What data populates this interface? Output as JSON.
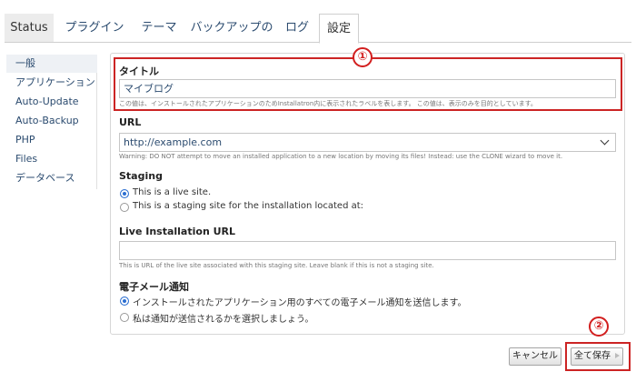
{
  "tabs": [
    {
      "label": "Status"
    },
    {
      "label": "プラグイン"
    },
    {
      "label": "テーマ"
    },
    {
      "label": "バックアップの"
    },
    {
      "label": "ログ"
    },
    {
      "label": "設定"
    }
  ],
  "sidebar": {
    "items": [
      {
        "label": "一般"
      },
      {
        "label": "アプリケーション"
      },
      {
        "label": "Auto-Update"
      },
      {
        "label": "Auto-Backup"
      },
      {
        "label": "PHP"
      },
      {
        "label": "Files"
      },
      {
        "label": "データベース"
      }
    ]
  },
  "form": {
    "title": {
      "label": "タイトル",
      "value": "マイブログ",
      "help": "この値は、インストールされたアプリケーションのためInstallatron内に表示されたラベルを表します。 この値は、表示のみを目的としています。"
    },
    "url": {
      "label": "URL",
      "value": "http://example.com",
      "help": "Warning: DO NOT attempt to move an installed application to a new location by moving its files! Instead: use the CLONE wizard to move it."
    },
    "staging": {
      "label": "Staging",
      "options": [
        "This is a live site.",
        "This is a staging site for the installation located at:"
      ]
    },
    "live_url": {
      "label": "Live Installation URL",
      "value": "",
      "help": "This is URL of the live site associated with this staging site. Leave blank if this is not a staging site."
    },
    "email": {
      "label": "電子メール通知",
      "options": [
        "インストールされたアプリケーション用のすべての電子メール通知を送信します。",
        "私は通知が送信されるかを選択しましょう。"
      ]
    }
  },
  "buttons": {
    "cancel": "キャンセル",
    "save_all": "全て保存"
  },
  "annotations": {
    "one": "①",
    "two": "②"
  },
  "colors": {
    "annotation_red": "#cc2424",
    "link_blue": "#2b4b6f",
    "radio_blue": "#2c6fd1"
  }
}
